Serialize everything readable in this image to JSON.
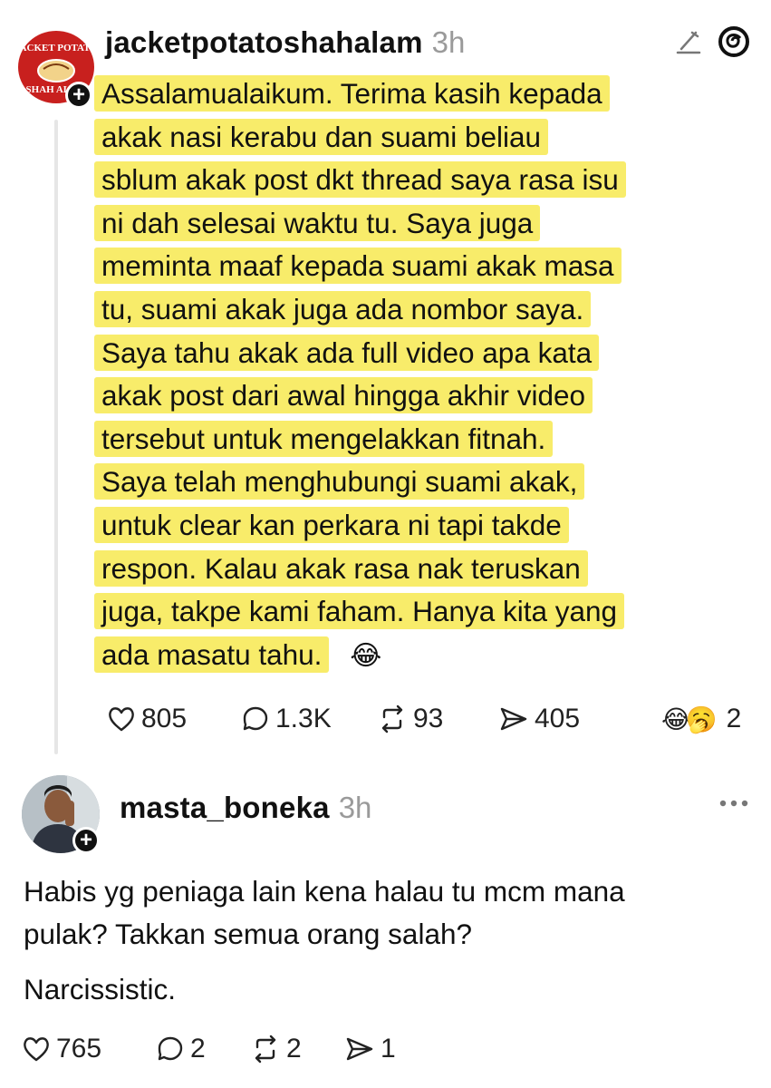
{
  "post1": {
    "username": "jacketpotatoshahalam",
    "time": "3h",
    "avatar_logo": [
      "JACKET POTATO",
      "SHAH ALAM"
    ],
    "lines": [
      "Assalamualaikum. Terima kasih kepada",
      "akak nasi kerabu dan suami beliau",
      "sblum akak post dkt thread saya rasa isu",
      "ni dah selesai waktu tu. Saya juga",
      "meminta maaf kepada suami akak masa",
      "tu, suami akak juga ada nombor saya.",
      "Saya tahu akak ada full video apa kata",
      "akak post dari awal hingga akhir video",
      "tersebut untuk mengelakkan fitnah.",
      "Saya telah menghubungi suami akak,",
      "untuk clear kan perkara ni tapi takde",
      "respon. Kalau akak rasa nak teruskan",
      "juga, takpe kami faham. Hanya kita yang",
      "ada masatu tahu."
    ],
    "trailing_emoji": "😂",
    "likes": "805",
    "replies": "1.3K",
    "reposts": "93",
    "shares": "405",
    "reactions_emoji": "😂🥱",
    "reactions_count": "2",
    "header_icons": [
      "edit-icon",
      "threads-logo-icon"
    ]
  },
  "post2": {
    "username": "masta_boneka",
    "time": "3h",
    "text_lines": [
      "Habis yg peniaga lain kena halau tu mcm mana",
      "pulak? Takkan semua orang salah?"
    ],
    "text2": "Narcissistic.",
    "likes": "765",
    "replies": "2",
    "reposts": "2",
    "shares": "1",
    "menu_icon": "more-dots-icon"
  },
  "colors": {
    "highlight": "#f8ec6a",
    "accent_logo": "#c8201e",
    "muted": "#9a9a9a"
  }
}
